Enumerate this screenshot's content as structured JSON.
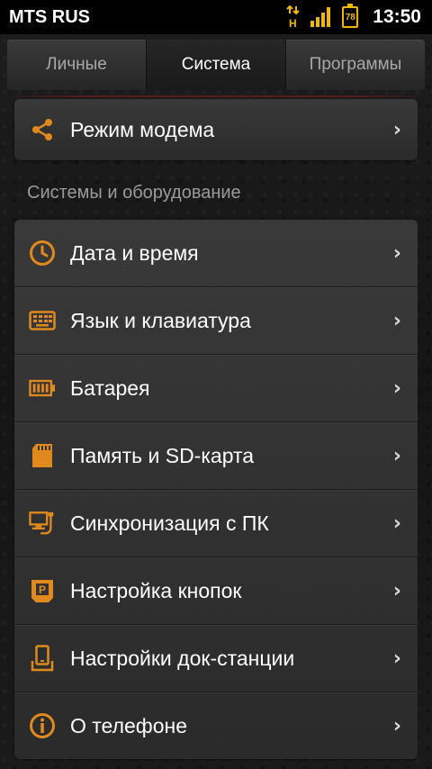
{
  "status": {
    "carrier": "MTS RUS",
    "battery": "78",
    "time": "13:50",
    "network_letter": "H"
  },
  "tabs": [
    {
      "label": "Личные",
      "active": false
    },
    {
      "label": "Система",
      "active": true
    },
    {
      "label": "Программы",
      "active": false
    }
  ],
  "modem_item": {
    "label": "Режим модема",
    "icon": "share-icon"
  },
  "section_title": "Системы и оборудование",
  "items": [
    {
      "label": "Дата и время",
      "icon": "clock-icon"
    },
    {
      "label": "Язык и клавиатура",
      "icon": "keyboard-icon"
    },
    {
      "label": "Батарея",
      "icon": "battery-icon"
    },
    {
      "label": "Память и SD-карта",
      "icon": "sd-card-icon"
    },
    {
      "label": "Синхронизация с ПК",
      "icon": "pc-sync-icon"
    },
    {
      "label": "Настройка кнопок",
      "icon": "buttons-icon"
    },
    {
      "label": "Настройки док-станции",
      "icon": "dock-icon"
    },
    {
      "label": "О телефоне",
      "icon": "info-icon"
    }
  ],
  "chevron": "›",
  "colors": {
    "accent": "#e08a1e",
    "status_yellow": "#f0b800"
  }
}
